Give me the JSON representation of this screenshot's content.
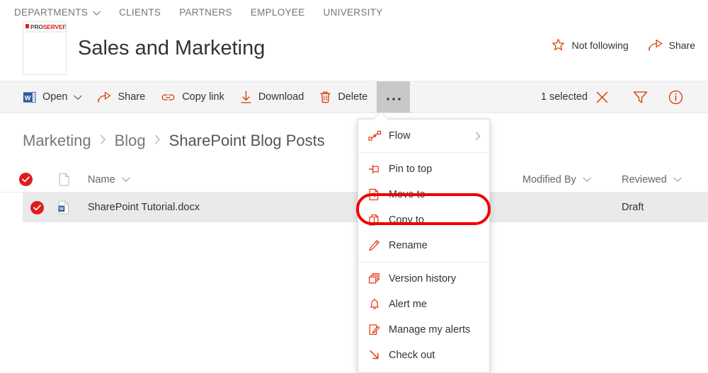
{
  "topnav": {
    "items": [
      {
        "label": "DEPARTMENTS",
        "has_chevron": true,
        "icon": "chevron-down-icon"
      },
      {
        "label": "CLIENTS",
        "has_chevron": false
      },
      {
        "label": "PARTNERS",
        "has_chevron": false
      },
      {
        "label": "EMPLOYEE",
        "has_chevron": false
      },
      {
        "label": "UNIVERSITY",
        "has_chevron": false
      }
    ]
  },
  "site": {
    "title": "Sales and Marketing",
    "logo": {
      "pro": "PRO",
      "serve": "SERVE",
      "it": "IT",
      "tagline": "MAKING TECHNOLOGY WORK FOR YOU",
      "accent_color": "#e02020"
    },
    "actions": [
      {
        "label": "Not following",
        "icon": "star-outline-icon",
        "color": "#d83b01"
      },
      {
        "label": "Share",
        "icon": "share-icon",
        "color": "#d83b01"
      }
    ]
  },
  "commandbar": {
    "items": [
      {
        "label": "Open",
        "icon": "word-document-icon",
        "has_chevron": true
      },
      {
        "label": "Share",
        "icon": "share-icon",
        "has_chevron": false
      },
      {
        "label": "Copy link",
        "icon": "link-icon",
        "has_chevron": false
      },
      {
        "label": "Download",
        "icon": "download-icon",
        "has_chevron": false
      },
      {
        "label": "Delete",
        "icon": "trash-icon",
        "has_chevron": false
      }
    ],
    "more_label": "…",
    "more_icon": "ellipsis-icon",
    "selected_text": "1 selected",
    "clear_selection_icon": "close-icon",
    "filter_icon": "filter-icon",
    "info_icon": "info-icon",
    "accent_color": "#d83b01"
  },
  "breadcrumb": {
    "crumbs": [
      "Marketing",
      "Blog",
      "SharePoint Blog Posts"
    ],
    "separator": "›"
  },
  "list": {
    "headers": {
      "name": "Name",
      "modified_by": "Modified By",
      "reviewed": "Reviewed"
    },
    "rows": [
      {
        "name": "SharePoint Tutorial.docx",
        "icon": "word-file-icon",
        "modified_by": "",
        "reviewed": "Draft",
        "selected": true
      }
    ],
    "select_all_checked": true,
    "check_color": "#e01b1b"
  },
  "menu": {
    "items": [
      {
        "label": "Flow",
        "icon": "flow-icon",
        "submenu": true,
        "divider_after": true
      },
      {
        "label": "Pin to top",
        "icon": "pin-icon",
        "submenu": false,
        "divider_after": false
      },
      {
        "label": "Move to",
        "icon": "move-to-icon",
        "submenu": false,
        "divider_after": false
      },
      {
        "label": "Copy to",
        "icon": "copy-to-icon",
        "submenu": false,
        "divider_after": false,
        "highlighted": true
      },
      {
        "label": "Rename",
        "icon": "rename-pencil-icon",
        "submenu": false,
        "divider_after": true
      },
      {
        "label": "Version history",
        "icon": "version-history-icon",
        "submenu": false,
        "divider_after": false
      },
      {
        "label": "Alert me",
        "icon": "bell-icon",
        "submenu": false,
        "divider_after": false
      },
      {
        "label": "Manage my alerts",
        "icon": "manage-alerts-icon",
        "submenu": false,
        "divider_after": false
      },
      {
        "label": "Check out",
        "icon": "check-out-arrow-icon",
        "submenu": false,
        "divider_after": false
      }
    ],
    "icon_color": "#e8401f",
    "highlight_border_color": "#ef0000"
  }
}
